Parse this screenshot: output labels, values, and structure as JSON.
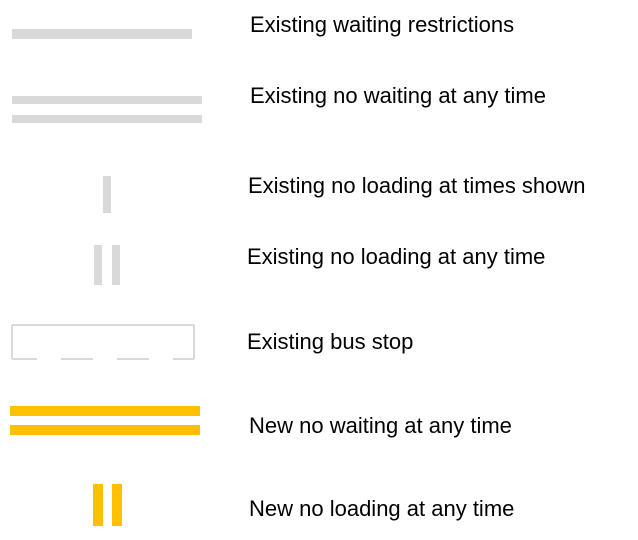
{
  "legend": {
    "items": [
      {
        "key": "existing_waiting_restrictions",
        "label": "Existing waiting restrictions",
        "symbol": "single-line",
        "color": "#d9d9d9"
      },
      {
        "key": "existing_no_waiting_any_time",
        "label": "Existing no waiting at any time",
        "symbol": "double-line",
        "color": "#d9d9d9"
      },
      {
        "key": "existing_no_loading_times_shown",
        "label": "Existing no loading at times shown",
        "symbol": "single-kerb-mark",
        "color": "#d9d9d9"
      },
      {
        "key": "existing_no_loading_any_time",
        "label": "Existing no loading at any time",
        "symbol": "double-kerb-mark",
        "color": "#d9d9d9"
      },
      {
        "key": "existing_bus_stop",
        "label": "Existing bus stop",
        "symbol": "bus-stop-box",
        "color": "#d9d9d9"
      },
      {
        "key": "new_no_waiting_any_time",
        "label": "New no waiting at any time",
        "symbol": "double-line",
        "color": "#ffc000"
      },
      {
        "key": "new_no_loading_any_time",
        "label": "New no loading at any time",
        "symbol": "double-kerb-mark",
        "color": "#ffc000"
      }
    ]
  }
}
